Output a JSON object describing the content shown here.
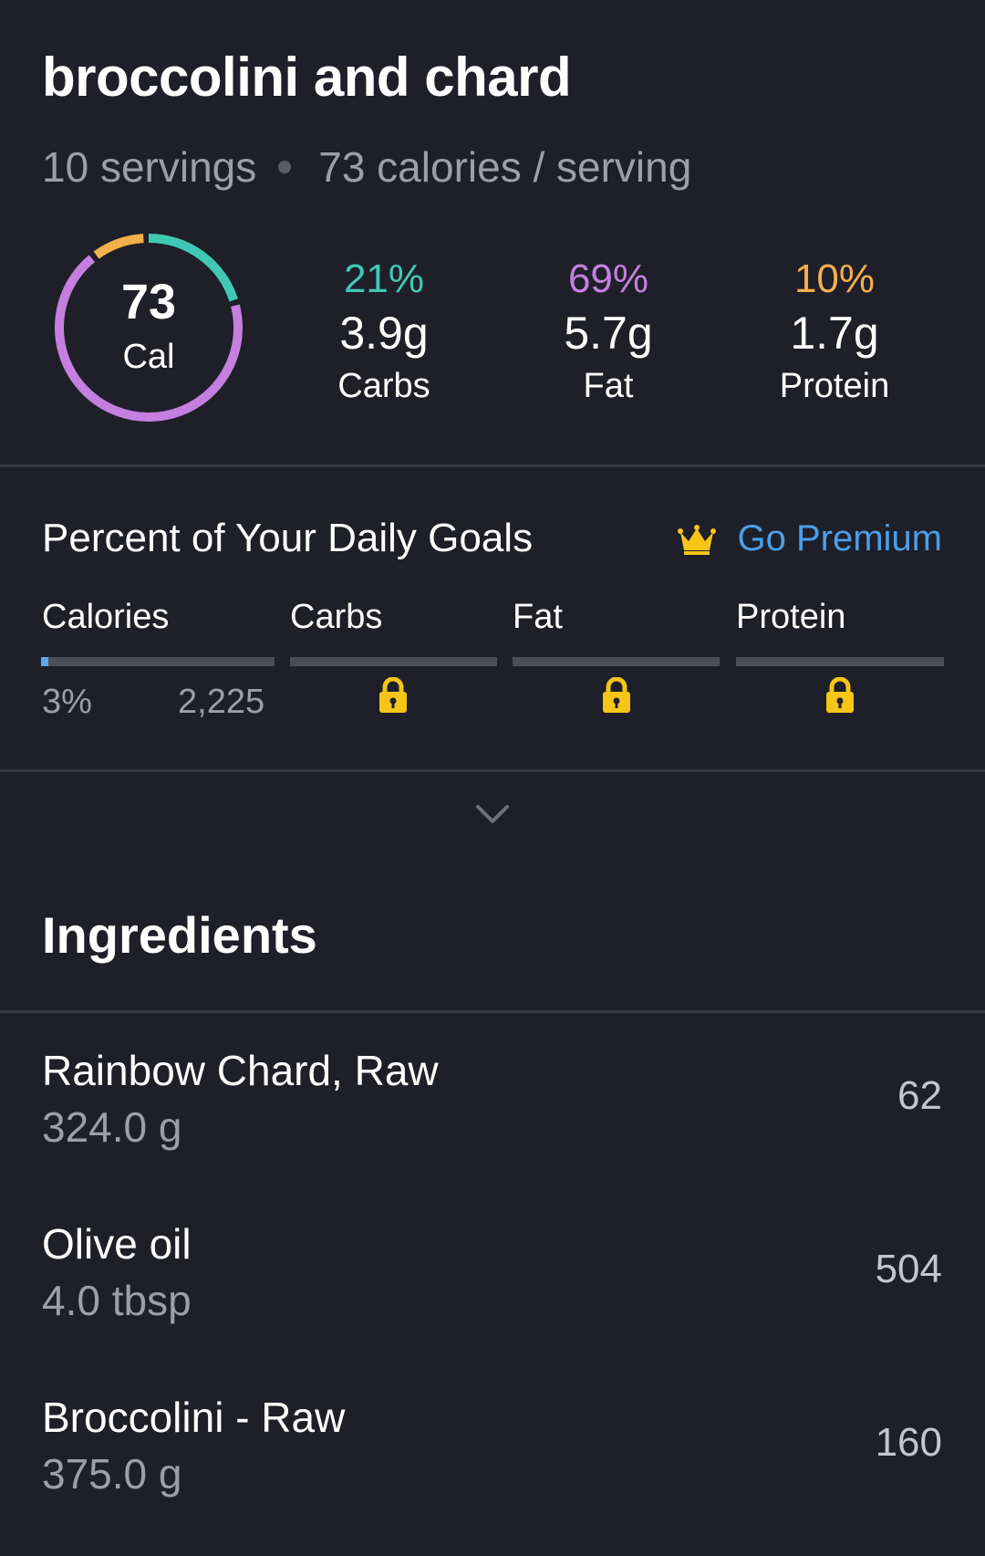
{
  "recipe": {
    "title": "broccolini and chard",
    "servings": "10 servings",
    "calories_per_serving": "73 calories / serving"
  },
  "summary": {
    "calories_value": "73",
    "calories_unit": "Cal",
    "ring_shares": {
      "carbs": 0.21,
      "fat": 0.69,
      "protein": 0.1
    },
    "macros": [
      {
        "pct": "21%",
        "grams": "3.9g",
        "name": "Carbs",
        "color": "#3fc9b4"
      },
      {
        "pct": "69%",
        "grams": "5.7g",
        "name": "Fat",
        "color": "#c47fe0"
      },
      {
        "pct": "10%",
        "grams": "1.7g",
        "name": "Protein",
        "color": "#f3b04c"
      }
    ]
  },
  "goals": {
    "title": "Percent of Your Daily Goals",
    "premium_label": "Go Premium",
    "premium_icon": "crown-icon",
    "columns": [
      {
        "name": "Calories"
      },
      {
        "name": "Carbs",
        "locked": true
      },
      {
        "name": "Fat",
        "locked": true
      },
      {
        "name": "Protein",
        "locked": true
      }
    ],
    "calories_pct": "3%",
    "calories_goal": "2,225",
    "calories_progress": 0.03,
    "lock_icon": "lock-icon",
    "expand_icon": "chevron-down-icon"
  },
  "ingredients": {
    "title": "Ingredients",
    "items": [
      {
        "name": "Rainbow Chard, Raw",
        "qty": "324.0 g",
        "cal": "62"
      },
      {
        "name": "Olive oil",
        "qty": "4.0 tbsp",
        "cal": "504"
      },
      {
        "name": "Broccolini - Raw",
        "qty": "375.0 g",
        "cal": "160"
      }
    ]
  },
  "colors": {
    "background": "#1e1f29",
    "carbs": "#3fc9b4",
    "fat": "#c47fe0",
    "protein": "#f3b04c",
    "link": "#4a9fe8",
    "lock": "#f5c518"
  }
}
